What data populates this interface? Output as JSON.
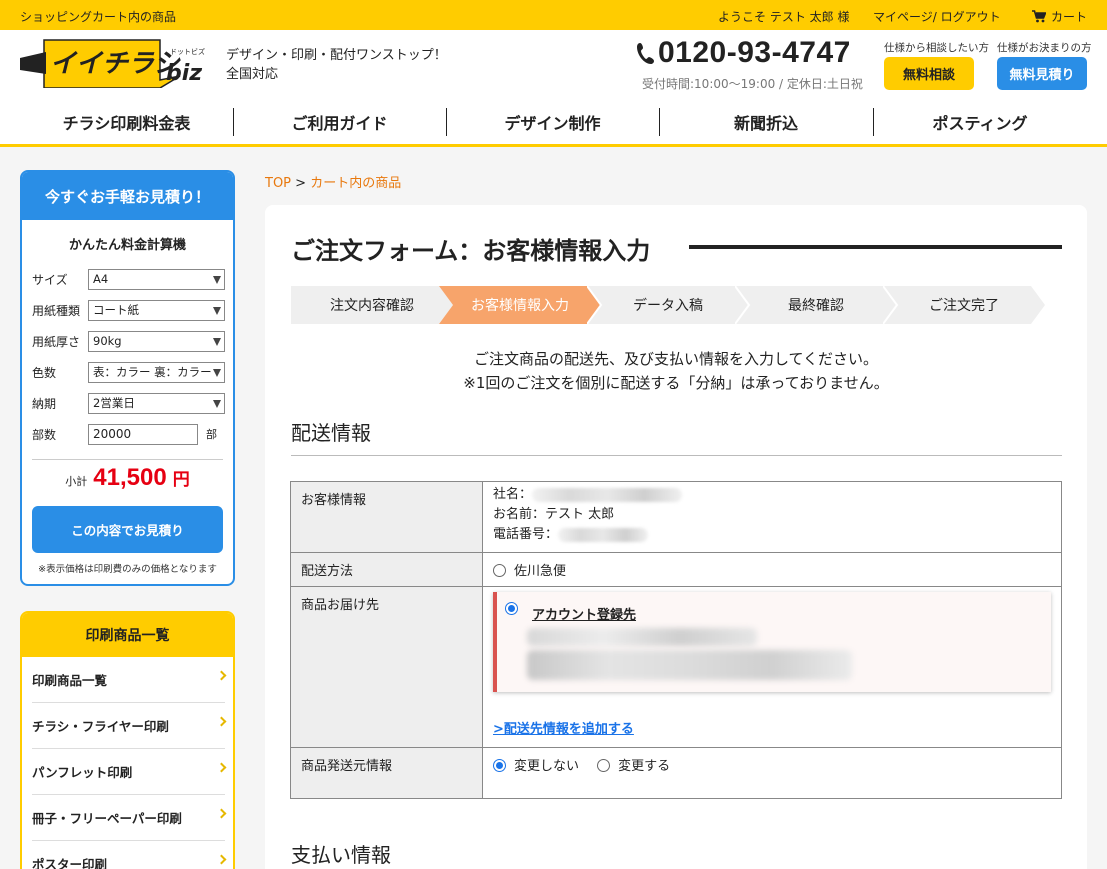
{
  "topbar": {
    "page_label": "ショッピングカート内の商品",
    "welcome": "ようこそ テスト 太郎 様",
    "mypage": "マイページ/ ログアウト",
    "cart": "カート"
  },
  "header": {
    "logo_text": "イイチラシ",
    "logo_sub": "biz",
    "logo_ruby": "ドットビズ",
    "tagline_1": "デザイン・印刷・配付ワンストップ！",
    "tagline_2": "全国対応",
    "phone": "0120-93-4747",
    "hours": "受付時間:10:00〜19:00 / 定休日:土日祝",
    "consult_label": "仕様から相談したい方",
    "consult_button": "無料相談",
    "estimate_label": "仕様がお決まりの方",
    "estimate_button": "無料見積り"
  },
  "nav": [
    "チラシ印刷料金表",
    "ご利用ガイド",
    "デザイン制作",
    "新聞折込",
    "ポスティング"
  ],
  "calculator": {
    "heading": "今すぐお手軽お見積り！",
    "title": "かんたん料金計算機",
    "fields": [
      {
        "label": "サイズ",
        "value": "A4"
      },
      {
        "label": "用紙種類",
        "value": "コート紙"
      },
      {
        "label": "用紙厚さ",
        "value": "90kg"
      },
      {
        "label": "色数",
        "value": "表：カラー 裏：カラー"
      },
      {
        "label": "納期",
        "value": "2営業日"
      }
    ],
    "qty_label": "部数",
    "qty_value": "20000",
    "qty_unit": "部",
    "subtotal_label": "小計",
    "subtotal_amount": "41,500",
    "subtotal_unit": "円",
    "submit": "この内容でお見積り",
    "note": "※表示価格は印刷費のみの価格となります"
  },
  "products": {
    "heading": "印刷商品一覧",
    "items": [
      "印刷商品一覧",
      "チラシ・フライヤー印刷",
      "パンフレット印刷",
      "冊子・フリーペーパー印刷",
      "ポスター印刷"
    ]
  },
  "breadcrumb": {
    "top": "TOP",
    "sep": " > ",
    "current": "カート内の商品"
  },
  "form": {
    "title": "ご注文フォーム：お客様情報入力",
    "steps": [
      "注文内容確認",
      "お客様情報入力",
      "データ入稿",
      "最終確認",
      "ご注文完了"
    ],
    "active_step": 1,
    "intro_1": "ご注文商品の配送先、及び支払い情報を入力してください。",
    "intro_2": "※1回のご注文を個別に配送する「分納」は承っておりません。",
    "shipping_section": "配送情報",
    "payment_section": "支払い情報",
    "rows": {
      "customer_label": "お客様情報",
      "company_label": "社名：",
      "name_label": "お名前：テスト 太郎",
      "tel_label": "電話番号：",
      "method_label": "配送方法",
      "method_option": "佐川急便",
      "dest_label": "商品お届け先",
      "dest_account": "アカウント登録先",
      "dest_add": ">配送先情報を追加する",
      "sender_label": "商品発送元情報",
      "sender_no_change": "変更しない",
      "sender_change": "変更する"
    }
  },
  "colors": {
    "yellow": "#ffcc00",
    "blue": "#2a8ee6",
    "step_active": "#f7a46b",
    "step_inactive": "#efefef",
    "price_red": "#e60012",
    "link_orange": "#e8780d"
  }
}
